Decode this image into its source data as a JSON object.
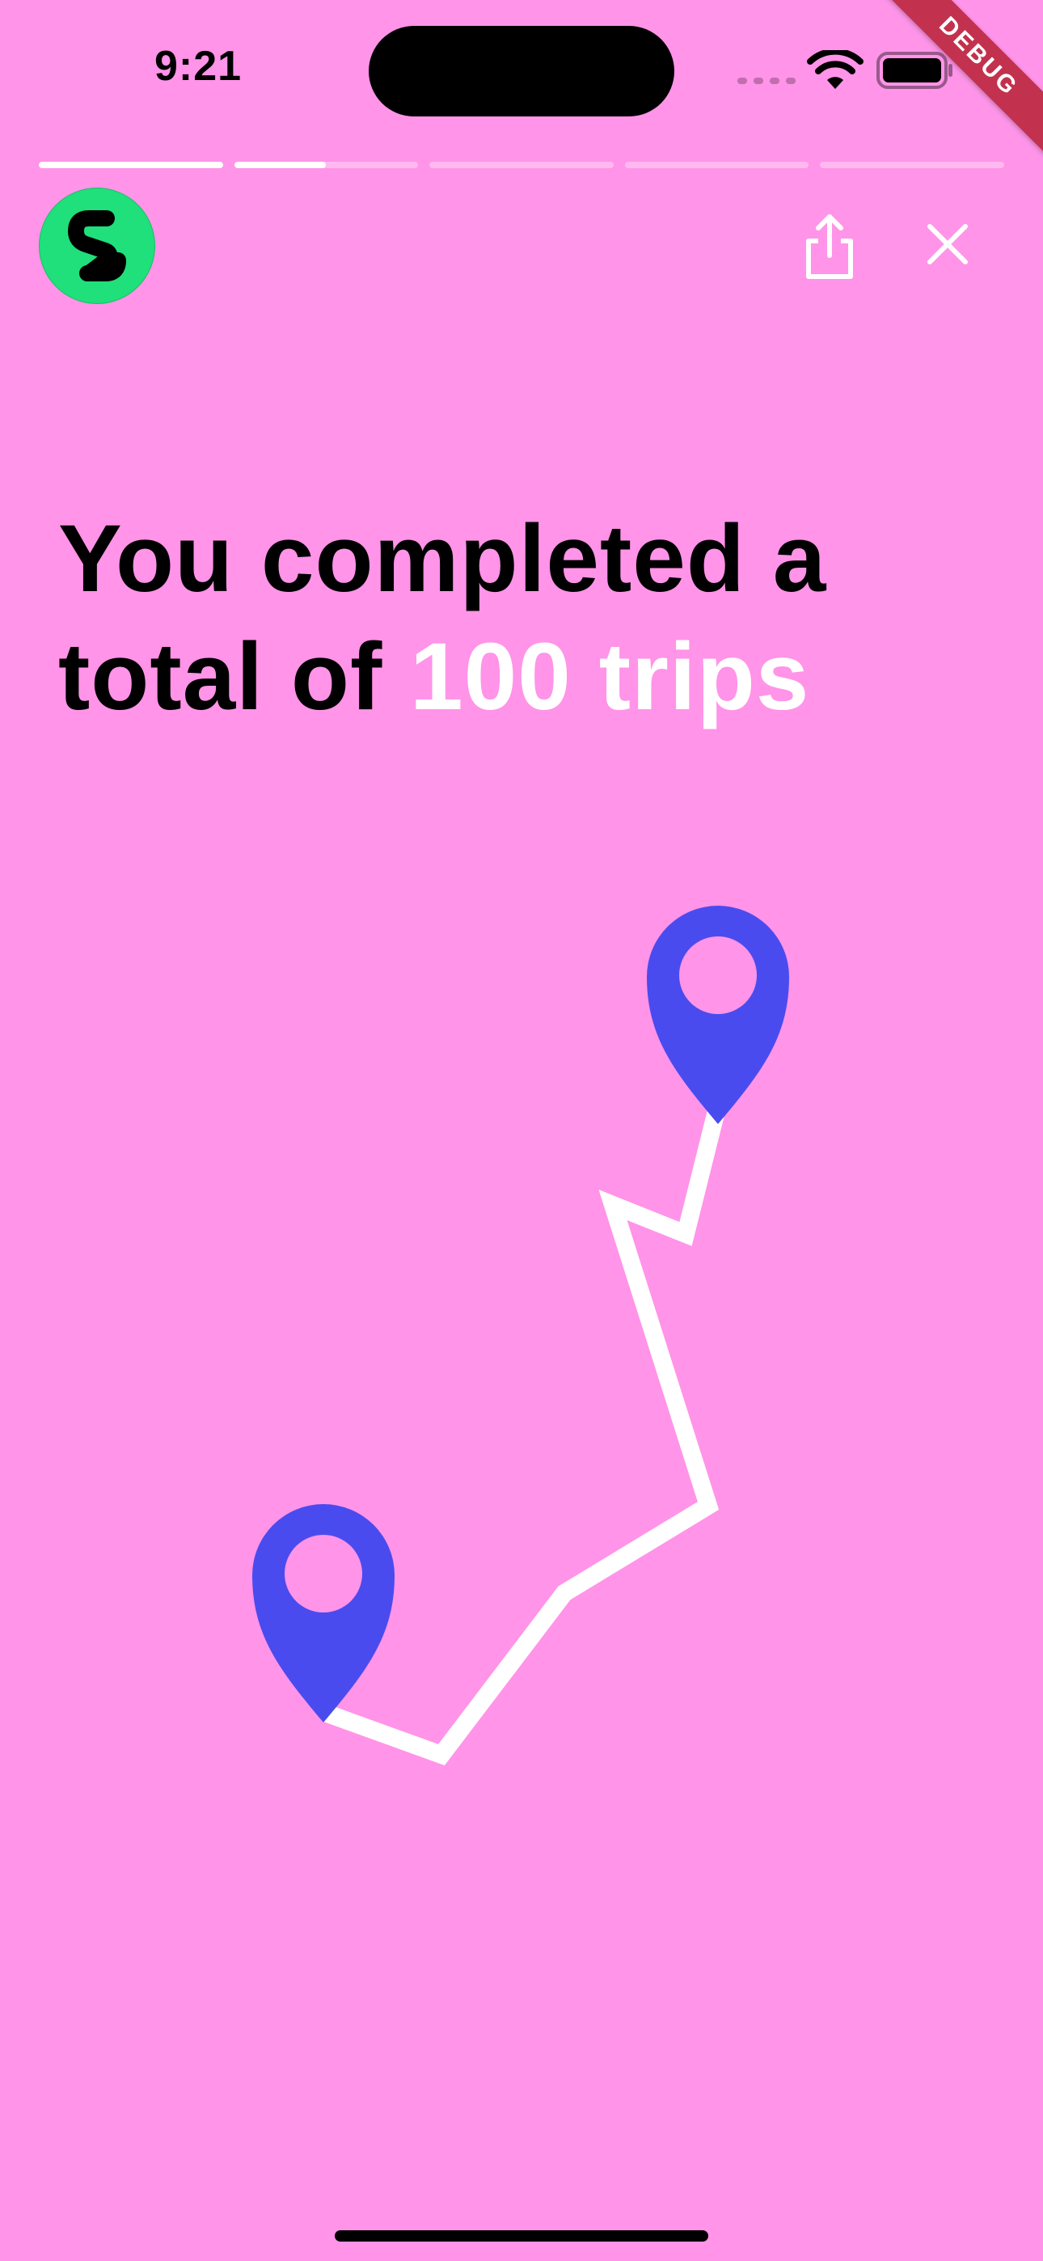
{
  "status_bar": {
    "time": "9:21"
  },
  "debug_banner": {
    "label": "DEBUG"
  },
  "story_progress": {
    "segments": [
      {
        "progress": 1.0
      },
      {
        "progress": 0.5
      },
      {
        "progress": 0.0
      },
      {
        "progress": 0.0
      },
      {
        "progress": 0.0
      }
    ]
  },
  "header": {
    "logo_icon": "app-logo-s",
    "share_icon": "share-icon",
    "close_icon": "close-icon"
  },
  "headline": {
    "prefix": "You completed a total of ",
    "highlight": "100 trips"
  },
  "illustration": {
    "pin_icon": "map-pin-icon",
    "route_icon": "route-line"
  },
  "colors": {
    "background": "#FF94E8",
    "accent": "#ffffff",
    "pin": "#4A4BEF",
    "logo_bg": "#1FE07A"
  }
}
